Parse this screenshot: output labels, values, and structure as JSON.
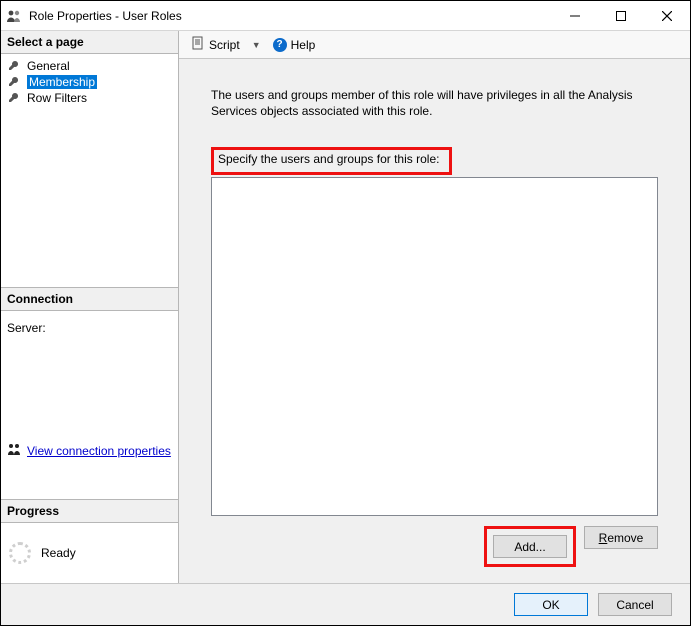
{
  "window": {
    "title": "Role Properties - User Roles"
  },
  "sidebar": {
    "pages_header": "Select a page",
    "items": [
      {
        "label": "General",
        "selected": false
      },
      {
        "label": "Membership",
        "selected": true
      },
      {
        "label": "Row Filters",
        "selected": false
      }
    ],
    "connection_header": "Connection",
    "server_label": "Server:",
    "view_conn_link": "View connection properties",
    "progress_header": "Progress",
    "progress_status": "Ready"
  },
  "toolbar": {
    "script_label": "Script",
    "help_label": "Help"
  },
  "main": {
    "description": "The users and groups member of this role will have privileges in all the Analysis Services objects associated with this role.",
    "specify_label": "Specify the users and groups for this role:",
    "add_label": "Add...",
    "remove_label": "Remove"
  },
  "footer": {
    "ok_label": "OK",
    "cancel_label": "Cancel"
  }
}
